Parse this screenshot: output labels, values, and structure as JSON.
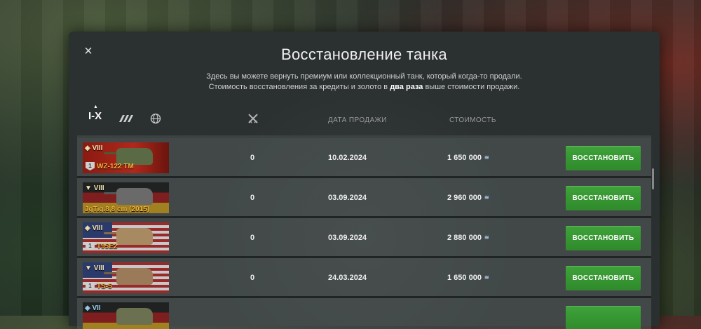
{
  "dialog": {
    "close_icon": "×",
    "title": "Восстановление танка",
    "desc_line1": "Здесь вы можете вернуть премиум или коллекционный танк, который когда-то продали.",
    "desc_line2_pre": "Стоимость восстановления за кредиты и золото в ",
    "desc_line2_bold": "два раза",
    "desc_line2_post": " выше стоимости продажи."
  },
  "filters": {
    "tier_label": "I-X",
    "caret": "▲"
  },
  "columns": {
    "date": "ДАТА ПРОДАЖИ",
    "cost": "СТОИМОСТЬ"
  },
  "colors": {
    "restore_button": "#3a9a35",
    "tank_name": "#f3b33a"
  },
  "rows": [
    {
      "tier": "VIII",
      "rank": "1",
      "name": "WZ-122 TM",
      "xp": "0",
      "date": "10.02.2024",
      "cost": "1 650 000",
      "button": "ВОССТАНОВИТЬ",
      "nation": "china"
    },
    {
      "tier": "VIII",
      "rank": "1",
      "name": "JgTig.8,8 cm (2015)",
      "xp": "0",
      "date": "03.09.2024",
      "cost": "2 960 000",
      "button": "ВОССТАНОВИТЬ",
      "nation": "germany"
    },
    {
      "tier": "VIII",
      "rank": "1",
      "name": "T95E2",
      "xp": "0",
      "date": "03.09.2024",
      "cost": "2 880 000",
      "button": "ВОССТАНОВИТЬ",
      "nation": "usa"
    },
    {
      "tier": "VIII",
      "rank": "1",
      "name": "TS-5",
      "xp": "0",
      "date": "24.03.2024",
      "cost": "1 650 000",
      "button": "ВОССТАНОВИТЬ",
      "nation": "usa"
    },
    {
      "tier": "VII",
      "rank": "",
      "name": "",
      "xp": "",
      "date": "",
      "cost": "",
      "button": "",
      "nation": "germany"
    }
  ]
}
